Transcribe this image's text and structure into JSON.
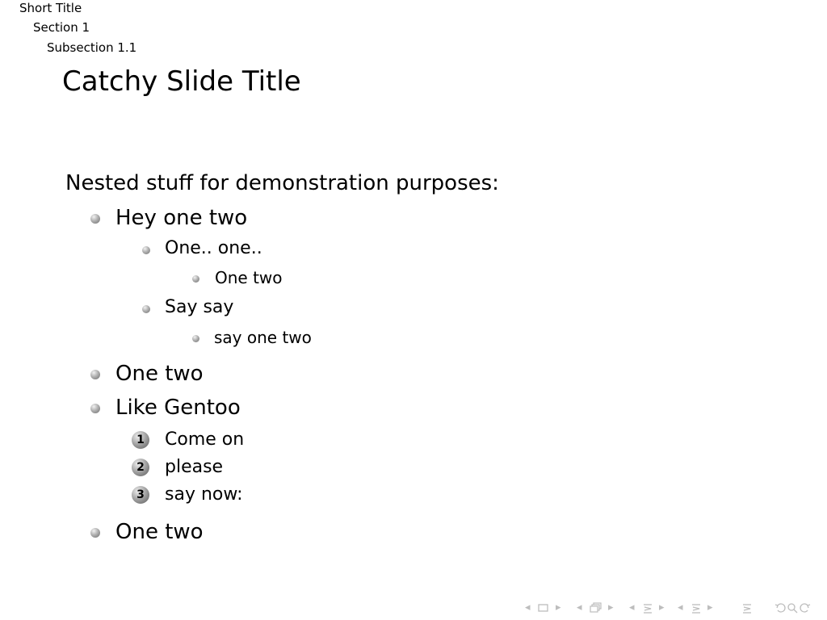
{
  "headline": {
    "short_title": "Short Title",
    "section": "Section 1",
    "subsection": "Subsection 1.1"
  },
  "frame": {
    "title": "Catchy Slide Title",
    "intro": "Nested stuff for demonstration purposes:"
  },
  "list": {
    "item1": "Hey one two",
    "item1_sub1": "One.. one..",
    "item1_sub1_sub1": "One two",
    "item1_sub2": "Say say",
    "item1_sub2_sub1": "say one two",
    "item2": "One two",
    "item3": "Like Gentoo",
    "item3_enum1_num": "1",
    "item3_enum1": "Come on",
    "item3_enum2_num": "2",
    "item3_enum2": "please",
    "item3_enum3_num": "3",
    "item3_enum3": "say now:",
    "item4": "One two"
  },
  "navigation": {
    "icons": {
      "frame_prev": "triangle-left-icon",
      "frame": "frame-icon",
      "frame_next": "triangle-right-icon",
      "subsection_prev": "triangle-left-icon",
      "subsection": "subsection-icon",
      "subsection_next": "triangle-right-icon",
      "section_prev": "triangle-left-icon",
      "section": "section-icon",
      "section_next": "triangle-right-icon",
      "presentation_prev": "triangle-left-icon",
      "presentation": "presentation-icon",
      "presentation_next": "triangle-right-icon",
      "appendix": "appendix-icon",
      "back": "back-icon",
      "search": "search-icon",
      "forward": "forward-icon"
    }
  },
  "colors": {
    "text": "#000000",
    "nav": "#bdbdbd",
    "bullet_light": "#f2f2f2",
    "bullet_dark": "#6b6b6b"
  }
}
